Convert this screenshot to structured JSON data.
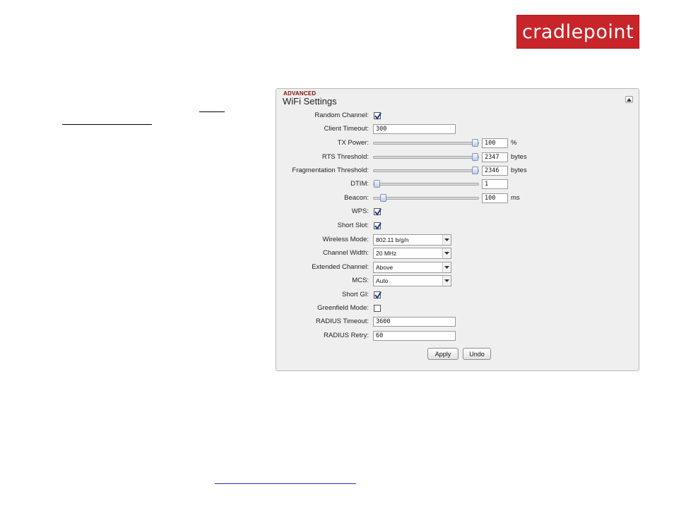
{
  "brand": {
    "logo_text": "cradlepoint",
    "logo_color": "#c8252a"
  },
  "panel": {
    "section": "ADVANCED",
    "title": "WiFi Settings",
    "collapse_icon": "collapse-up-icon"
  },
  "fields": {
    "random_channel": {
      "label": "Random Channel:",
      "checked": true
    },
    "client_timeout": {
      "label": "Client Timeout:",
      "value": "300"
    },
    "tx_power": {
      "label": "TX Power:",
      "value": "100",
      "unit": "%",
      "slider_fraction": 1.0
    },
    "rts_threshold": {
      "label": "RTS Threshold:",
      "value": "2347",
      "unit": "bytes",
      "slider_fraction": 1.0
    },
    "fragmentation_threshold": {
      "label": "Fragmentation Threshold:",
      "value": "2346",
      "unit": "bytes",
      "slider_fraction": 1.0
    },
    "dtim": {
      "label": "DTIM:",
      "value": "1",
      "slider_fraction": 0.0
    },
    "beacon": {
      "label": "Beacon:",
      "value": "100",
      "unit": "ms",
      "slider_fraction": 0.06
    },
    "wps": {
      "label": "WPS:",
      "checked": true
    },
    "short_slot": {
      "label": "Short Slot:",
      "checked": true
    },
    "wireless_mode": {
      "label": "Wireless Mode:",
      "value": "802.11 b/g/n"
    },
    "channel_width": {
      "label": "Channel Width:",
      "value": "20 MHz"
    },
    "extended_channel": {
      "label": "Extended Channel:",
      "value": "Above"
    },
    "mcs": {
      "label": "MCS:",
      "value": "Auto"
    },
    "short_gi": {
      "label": "Short GI:",
      "checked": true
    },
    "greenfield_mode": {
      "label": "Greenfield Mode:",
      "checked": false
    },
    "radius_timeout": {
      "label": "RADIUS Timeout:",
      "value": "3600"
    },
    "radius_retry": {
      "label": "RADIUS Retry:",
      "value": "60"
    }
  },
  "buttons": {
    "apply": "Apply",
    "undo": "Undo"
  }
}
